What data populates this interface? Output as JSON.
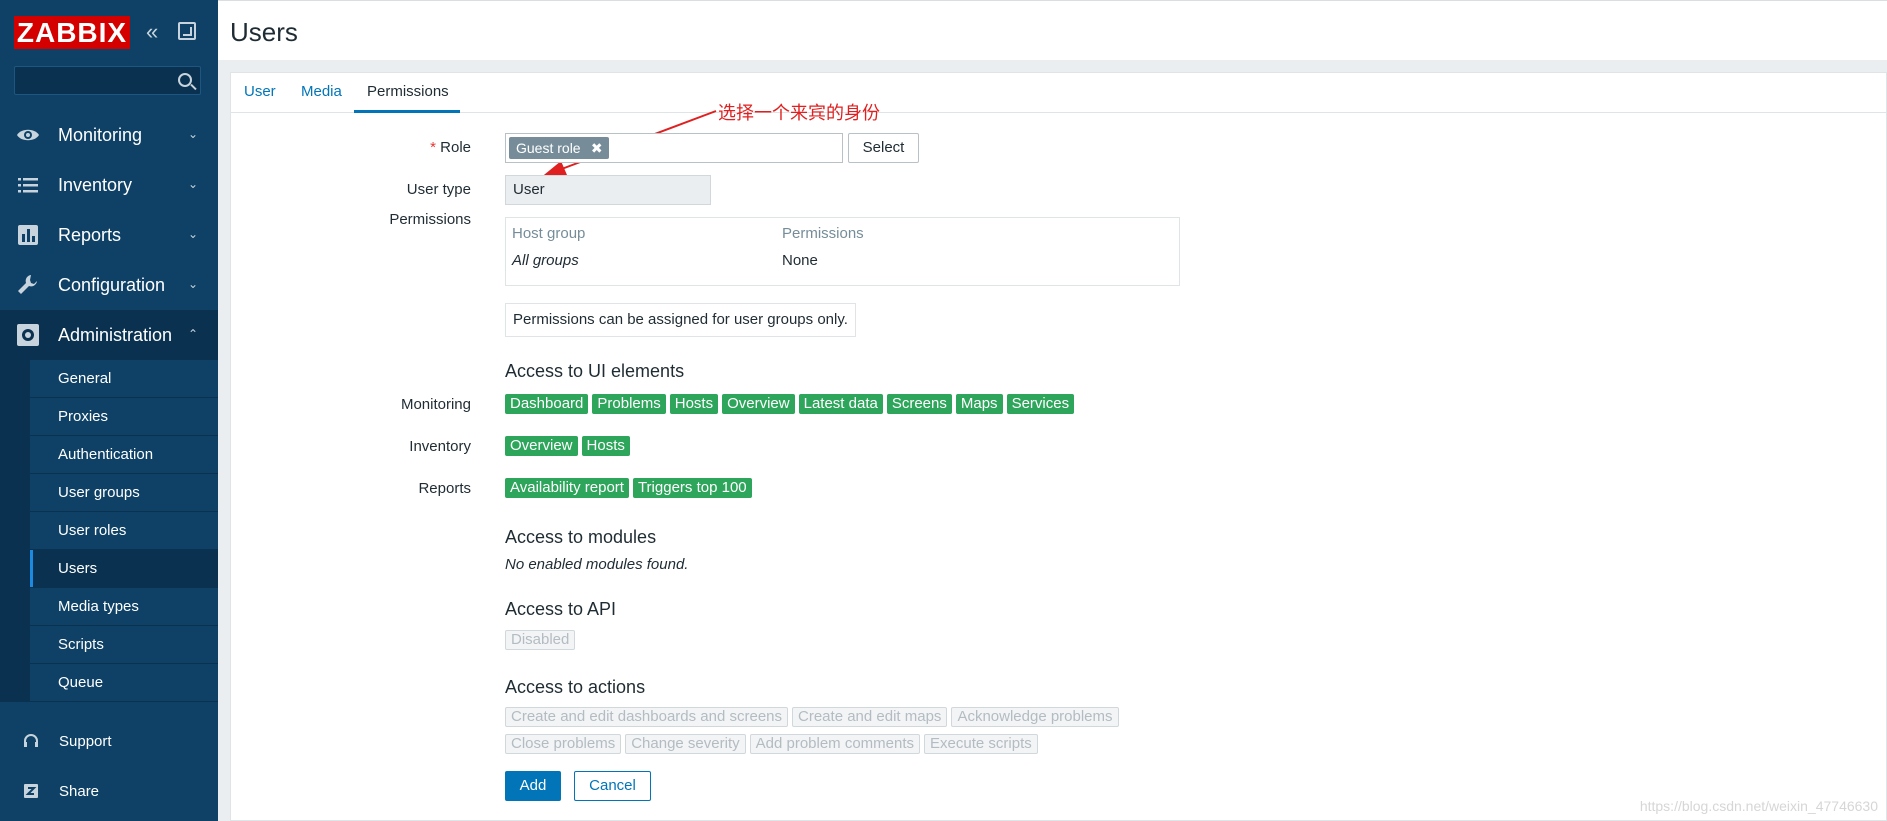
{
  "sidebar": {
    "logo": "ZABBIX",
    "search_placeholder": "",
    "nav": [
      {
        "label": "Monitoring",
        "caret": "⌄"
      },
      {
        "label": "Inventory",
        "caret": "⌄"
      },
      {
        "label": "Reports",
        "caret": "⌄"
      },
      {
        "label": "Configuration",
        "caret": "⌄"
      },
      {
        "label": "Administration",
        "caret": "⌃"
      }
    ],
    "submenu": [
      "General",
      "Proxies",
      "Authentication",
      "User groups",
      "User roles",
      "Users",
      "Media types",
      "Scripts",
      "Queue"
    ],
    "footer": [
      {
        "label": "Support",
        "icon": "headset-icon"
      },
      {
        "label": "Share",
        "icon": "share-z-icon"
      }
    ]
  },
  "header": {
    "title": "Users"
  },
  "tabs": [
    {
      "label": "User"
    },
    {
      "label": "Media"
    },
    {
      "label": "Permissions"
    }
  ],
  "form": {
    "role_label": "Role",
    "role_required_mark": "*",
    "role_value": "Guest role",
    "role_remove": "✖",
    "select_label": "Select",
    "user_type_label": "User type",
    "user_type_value": "User",
    "permissions_label": "Permissions",
    "perm_table": {
      "headers": [
        "Host group",
        "Permissions"
      ],
      "row": [
        "All groups",
        "None"
      ]
    },
    "perm_note": "Permissions can be assigned for user groups only.",
    "ui_title": "Access to UI elements",
    "ui_rows": [
      {
        "label": "Monitoring",
        "tags": [
          "Dashboard",
          "Problems",
          "Hosts",
          "Overview",
          "Latest data",
          "Screens",
          "Maps",
          "Services"
        ]
      },
      {
        "label": "Inventory",
        "tags": [
          "Overview",
          "Hosts"
        ]
      },
      {
        "label": "Reports",
        "tags": [
          "Availability report",
          "Triggers top 100"
        ]
      }
    ],
    "modules_title": "Access to modules",
    "modules_note": "No enabled modules found.",
    "api_title": "Access to API",
    "api_tag": "Disabled",
    "actions_title": "Access to actions",
    "actions_row1": [
      "Create and edit dashboards and screens",
      "Create and edit maps",
      "Acknowledge problems"
    ],
    "actions_row2": [
      "Close problems",
      "Change severity",
      "Add problem comments",
      "Execute scripts"
    ],
    "add_label": "Add",
    "cancel_label": "Cancel"
  },
  "annotation": {
    "text": "选择一个来宾的身份"
  },
  "watermark": "https://blog.csdn.net/weixin_47746630",
  "colors": {
    "sidebar_bg": "#0e4165",
    "brand_red": "#d40000",
    "link_blue": "#0275b8",
    "tag_green": "#2da55a",
    "annotation_red": "#e02020"
  }
}
